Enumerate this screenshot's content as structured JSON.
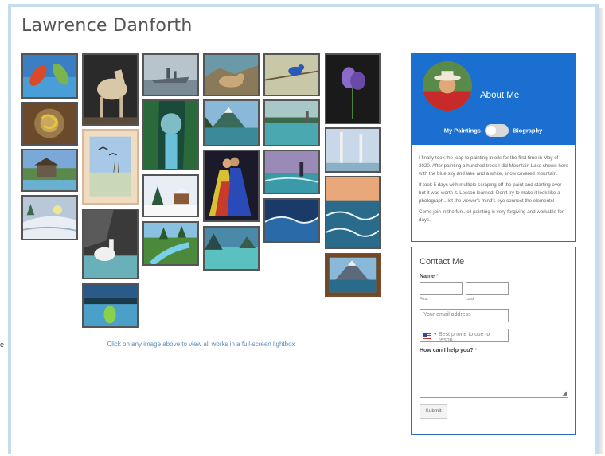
{
  "page": {
    "title": "Lawrence Danforth",
    "edge_char": "e"
  },
  "gallery": {
    "caption": "Click on any image above to view all works in a full-screen lightbox",
    "paintings": [
      {
        "name": "painting-feathers"
      },
      {
        "name": "painting-swirl"
      },
      {
        "name": "painting-cabin"
      },
      {
        "name": "painting-winter-sun"
      },
      {
        "name": "painting-horse"
      },
      {
        "name": "painting-birds-marsh"
      },
      {
        "name": "painting-white-horse-rocks"
      },
      {
        "name": "painting-green-reflection"
      },
      {
        "name": "painting-ship"
      },
      {
        "name": "painting-waterfall"
      },
      {
        "name": "painting-winter-cabin"
      },
      {
        "name": "painting-stream"
      },
      {
        "name": "painting-lynx"
      },
      {
        "name": "painting-mountain-lake"
      },
      {
        "name": "painting-couple"
      },
      {
        "name": "painting-lagoon"
      },
      {
        "name": "painting-bluebird"
      },
      {
        "name": "painting-lake-shore"
      },
      {
        "name": "painting-lighthouse"
      },
      {
        "name": "painting-wave"
      },
      {
        "name": "painting-iris"
      },
      {
        "name": "painting-birches"
      },
      {
        "name": "painting-sunset-waves"
      },
      {
        "name": "painting-mountain-lake-framed"
      }
    ]
  },
  "about": {
    "title": "About Me",
    "toggle_left": "My Paintings",
    "toggle_right": "Biography",
    "paragraphs": [
      "I finally took the leap to painting in oils for the first time in May of 2020. After painting a hundred trees I did Mountain Lake shown here with the blue sky and lake and a white, snow covered mountain.",
      "It took 5 days with multiple scraping off the paint and starting over but it was worth it. Lesson learned: Don't try to make it look like a photograph...let the viewer's mind's eye connect the elements!",
      "Come join in the fun...oil painting is very forgiving and workable for days."
    ],
    "accent": "#1a6fd0"
  },
  "contact": {
    "title": "Contact Me",
    "name_label": "Name",
    "required_mark": "*",
    "first_label": "First",
    "last_label": "Last",
    "email_placeholder": "Your email address",
    "phone_placeholder": "Best phone to use to respo",
    "phone_caret": "▾",
    "help_label": "How can I help you?",
    "submit_label": "Submit"
  }
}
